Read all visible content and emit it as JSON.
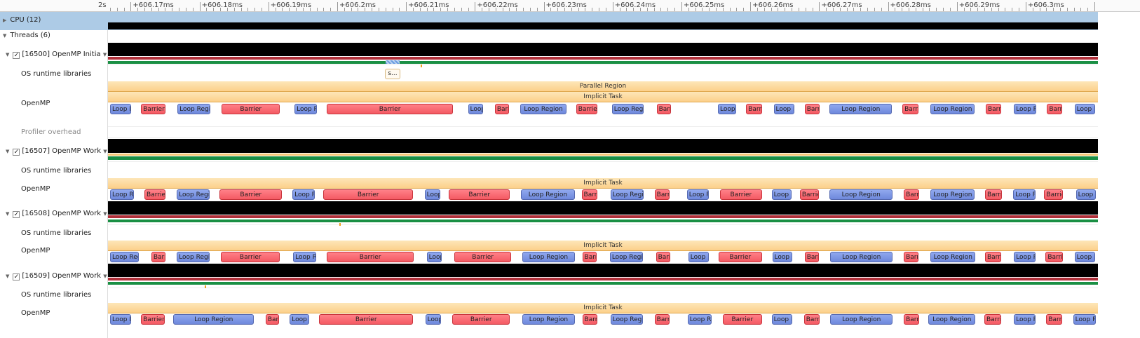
{
  "ruler": {
    "zero_label": "2s",
    "view_start_ms": 606.1667,
    "view_end_ms": 606.3105,
    "ticks": [
      "+606.17ms",
      "+606.18ms",
      "+606.19ms",
      "+606.2ms",
      "+606.21ms",
      "+606.22ms",
      "+606.23ms",
      "+606.24ms",
      "+606.25ms",
      "+606.26ms",
      "+606.27ms",
      "+606.28ms",
      "+606.29ms",
      "+606.3ms"
    ],
    "tick_values_ms": [
      606.17,
      606.18,
      606.19,
      606.2,
      606.21,
      606.22,
      606.23,
      606.24,
      606.25,
      606.26,
      606.27,
      606.28,
      606.29,
      606.3
    ]
  },
  "tree": {
    "cpu": "CPU (12)",
    "threads": "Threads (6)",
    "thread_rows": [
      {
        "label": "[16500] OpenMP Initia",
        "checked": "✓"
      },
      {
        "label": "[16507] OpenMP Work",
        "checked": "✓"
      },
      {
        "label": "[16508] OpenMP Work",
        "checked": "✓"
      },
      {
        "label": "[16509] OpenMP Work",
        "checked": "✓"
      }
    ],
    "os_runtime": "OS runtime libraries",
    "openmp": "OpenMP",
    "profiler_overhead": "Profiler overhead"
  },
  "colors": {
    "cpu_selected": "#adcbe6",
    "loop": "#7b93e3",
    "barrier": "#f76870",
    "task": "#fcd592",
    "running": "#1a8f44",
    "state_red": "#b0303a",
    "state_orange": "#f7c878"
  },
  "os_event": {
    "label": "s...",
    "start_ms": 606.207,
    "end_ms": 606.2091
  },
  "parallel_region": "Parallel Region",
  "implicit_task": "Implicit Task",
  "markers_ms": [
    606.2121,
    606.2003,
    606.1808
  ],
  "openmp_rows": [
    [
      [
        "Loop Region",
        606.167,
        606.1701
      ],
      [
        "Barrier",
        606.1715,
        606.1751
      ],
      [
        "Loop Region",
        606.1768,
        606.1816
      ],
      [
        "Barrier",
        606.1832,
        606.1917
      ],
      [
        "Loop Region",
        606.1938,
        606.197
      ],
      [
        "Barrier",
        606.1985,
        606.2168
      ],
      [
        "Loop Region",
        606.219,
        606.2212
      ],
      [
        "Barrier",
        606.2229,
        606.225
      ],
      [
        "Loop Region",
        606.2266,
        606.2333
      ],
      [
        "Barrier",
        606.2347,
        606.2378
      ],
      [
        "Loop Region",
        606.2399,
        606.2445
      ],
      [
        "Barrier",
        606.2464,
        606.2485
      ],
      [
        "Loop Region",
        606.2553,
        606.258
      ],
      [
        "Barrier",
        606.2594,
        606.2617
      ],
      [
        "Loop Region",
        606.2634,
        606.2664
      ],
      [
        "Barrier",
        606.2679,
        606.2701
      ],
      [
        "Loop Region",
        606.2715,
        606.2806
      ],
      [
        "Barrier",
        606.2821,
        606.2844
      ],
      [
        "Loop Region",
        606.2862,
        606.2926
      ],
      [
        "Barrier",
        606.2942,
        606.2964
      ],
      [
        "Loop Region",
        606.2983,
        606.3015
      ],
      [
        "Barrier",
        606.3031,
        606.3053
      ],
      [
        "Loop Region",
        606.3071,
        606.3101
      ]
    ],
    [
      [
        "Loop Region",
        606.167,
        606.1705
      ],
      [
        "Barrier",
        606.172,
        606.1751
      ],
      [
        "Loop Region",
        606.1767,
        606.1815
      ],
      [
        "Barrier",
        606.1829,
        606.192
      ],
      [
        "Loop Region",
        606.1935,
        606.1967
      ],
      [
        "Barrier",
        606.198,
        606.211
      ],
      [
        "Loop Region",
        606.2127,
        606.215
      ],
      [
        "Barrier",
        606.2162,
        606.2251
      ],
      [
        "Loop Region",
        606.2267,
        606.2345
      ],
      [
        "Barrier",
        606.2355,
        606.2378
      ],
      [
        "Loop Region",
        606.2397,
        606.2445
      ],
      [
        "Barrier",
        606.2461,
        606.2483
      ],
      [
        "Loop Region",
        606.2508,
        606.254
      ],
      [
        "Barrier",
        606.2556,
        606.2617
      ],
      [
        "Loop Region",
        606.2631,
        606.266
      ],
      [
        "Barrier",
        606.2672,
        606.27
      ],
      [
        "Loop Region",
        606.2715,
        606.2807
      ],
      [
        "Barrier",
        606.2823,
        606.2845
      ],
      [
        "Loop Region",
        606.2862,
        606.2926
      ],
      [
        "Barrier",
        606.2941,
        606.2965
      ],
      [
        "Loop Region",
        606.2982,
        606.3014
      ],
      [
        "Barrier",
        606.3027,
        606.3054
      ],
      [
        "Loop Region",
        606.3073,
        606.3102
      ]
    ],
    [
      [
        "Loop Region",
        606.167,
        606.1712
      ],
      [
        "Barrier",
        606.173,
        606.1751
      ],
      [
        "Loop Region",
        606.1767,
        606.1815
      ],
      [
        "Barrier",
        606.1831,
        606.1917
      ],
      [
        "Loop Region",
        606.1936,
        606.1969
      ],
      [
        "Barrier",
        606.1985,
        606.2111
      ],
      [
        "Loop Region",
        606.213,
        606.2152
      ],
      [
        "Barrier",
        606.217,
        606.2253
      ],
      [
        "Loop Region",
        606.2269,
        606.2345
      ],
      [
        "Barrier",
        606.2356,
        606.2377
      ],
      [
        "Loop Region",
        606.2396,
        606.2444
      ],
      [
        "Barrier",
        606.2463,
        606.2484
      ],
      [
        "Loop Region",
        606.251,
        606.254
      ],
      [
        "Barrier",
        606.2554,
        606.2617
      ],
      [
        "Loop Region",
        606.2632,
        606.2661
      ],
      [
        "Barrier",
        606.2679,
        606.27
      ],
      [
        "Loop Region",
        606.2716,
        606.2807
      ],
      [
        "Barrier",
        606.2823,
        606.2844
      ],
      [
        "Loop Region",
        606.2862,
        606.2927
      ],
      [
        "Barrier",
        606.2941,
        606.2964
      ],
      [
        "Loop Region",
        606.2983,
        606.3014
      ],
      [
        "Barrier",
        606.3029,
        606.3054
      ],
      [
        "Loop Region",
        606.3071,
        606.3101
      ]
    ],
    [
      [
        "Loop Region",
        606.167,
        606.1701
      ],
      [
        "Barrier",
        606.1715,
        606.175
      ],
      [
        "Loop Region",
        606.1762,
        606.1879
      ],
      [
        "Barrier",
        606.1896,
        606.1915
      ],
      [
        "Loop Region",
        606.1931,
        606.1959
      ],
      [
        "Barrier",
        606.1974,
        606.211
      ],
      [
        "Loop Region",
        606.2128,
        606.2151
      ],
      [
        "Barrier",
        606.2167,
        606.2251
      ],
      [
        "Loop Region",
        606.2269,
        606.2345
      ],
      [
        "Barrier",
        606.2356,
        606.2378
      ],
      [
        "Loop Region",
        606.2397,
        606.2444
      ],
      [
        "Barrier",
        606.2461,
        606.2483
      ],
      [
        "Loop Region",
        606.2509,
        606.2544
      ],
      [
        "Barrier",
        606.256,
        606.2617
      ],
      [
        "Loop Region",
        606.2631,
        606.2661
      ],
      [
        "Barrier",
        606.2678,
        606.2701
      ],
      [
        "Loop Region",
        606.2716,
        606.2807
      ],
      [
        "Barrier",
        606.2823,
        606.2845
      ],
      [
        "Loop Region",
        606.2859,
        606.2927
      ],
      [
        "Barrier",
        606.294,
        606.2964
      ],
      [
        "Loop Region",
        606.2983,
        606.3014
      ],
      [
        "Barrier",
        606.303,
        606.3053
      ],
      [
        "Loop Region",
        606.3069,
        606.3102
      ]
    ]
  ]
}
